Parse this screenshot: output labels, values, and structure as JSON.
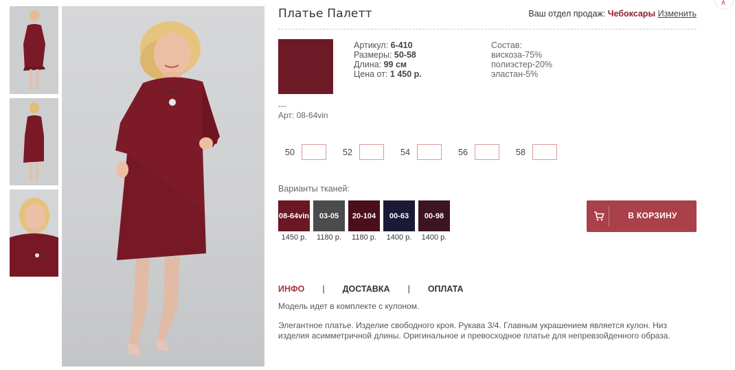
{
  "product": {
    "title": "Платье Палетт",
    "swatch_color": "#6e1a26",
    "specs": {
      "article_label": "Артикул:",
      "article_value": "6-410",
      "sizes_label": "Размеры:",
      "sizes_value": "50-58",
      "length_label": "Длина:",
      "length_value": "99 см",
      "price_label": "Цена от:",
      "price_value": "1 450 р."
    },
    "composition": {
      "label": "Состав:",
      "items": [
        "вискоза-75%",
        "полиэстер-20%",
        "эластан-5%"
      ]
    },
    "art_dash": "---",
    "art_line": "Арт: 08-64vin"
  },
  "sales": {
    "label": "Ваш отдел продаж:",
    "city": "Чебоксары",
    "change": "Изменить"
  },
  "sizes": [
    {
      "label": "50",
      "qty": ""
    },
    {
      "label": "52",
      "qty": ""
    },
    {
      "label": "54",
      "qty": ""
    },
    {
      "label": "56",
      "qty": ""
    },
    {
      "label": "58",
      "qty": ""
    }
  ],
  "fabrics": {
    "title": "Варианты тканей:",
    "items": [
      {
        "code": "08-64vin",
        "price": "1450 р.",
        "color": "#6b1724"
      },
      {
        "code": "03-05",
        "price": "1180 р.",
        "color": "#4a4b4d"
      },
      {
        "code": "20-104",
        "price": "1180 р.",
        "color": "#4a0f1c"
      },
      {
        "code": "00-63",
        "price": "1400 р.",
        "color": "#1b1a36"
      },
      {
        "code": "00-98",
        "price": "1400 р.",
        "color": "#3d1522"
      }
    ]
  },
  "cart": {
    "label": "В КОРЗИНУ",
    "color": "#a9404a",
    "icon": "cart-icon"
  },
  "tabs": [
    {
      "label": "ИНФО",
      "active": true
    },
    {
      "label": "ДОСТАВКА",
      "active": false
    },
    {
      "label": "ОПЛАТА",
      "active": false
    }
  ],
  "tab_separator": "|",
  "description": {
    "p1": "Модель идет в комплекте с кулоном.",
    "p2": "Элегантное платье. Изделие свободного кроя. Рукава 3/4. Главным украшением является кулон. Низ изделия асимметричной длины. Оригинальное и превосходное платье для непревзойденного образа."
  },
  "collapse_icon": "chevron-up-icon",
  "accent_color": "#a43441"
}
